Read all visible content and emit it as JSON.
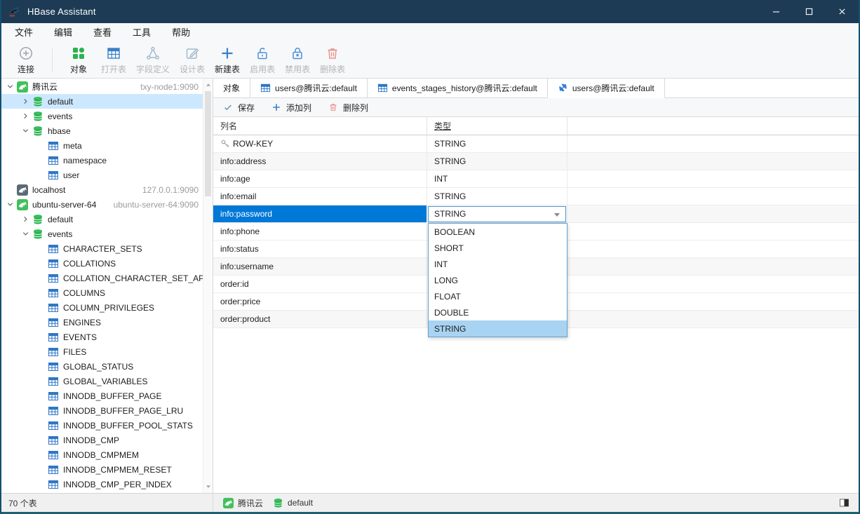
{
  "window": {
    "title": "HBase Assistant",
    "controls": [
      "minimize",
      "maximize",
      "close"
    ]
  },
  "menu": [
    "文件",
    "编辑",
    "查看",
    "工具",
    "帮助"
  ],
  "toolbar": [
    {
      "label": "连接",
      "icon": "connect-icon",
      "enabled": true,
      "sep_after": true
    },
    {
      "label": "对象",
      "icon": "objects-icon",
      "enabled": true
    },
    {
      "label": "打开表",
      "icon": "open-table-icon",
      "enabled": false
    },
    {
      "label": "字段定义",
      "icon": "field-def-icon",
      "enabled": false
    },
    {
      "label": "设计表",
      "icon": "design-table-icon",
      "enabled": false
    },
    {
      "label": "新建表",
      "icon": "new-table-icon",
      "enabled": true
    },
    {
      "label": "启用表",
      "icon": "enable-table-icon",
      "enabled": false
    },
    {
      "label": "禁用表",
      "icon": "disable-table-icon",
      "enabled": false
    },
    {
      "label": "删除表",
      "icon": "delete-table-icon",
      "enabled": false
    }
  ],
  "sidebar": {
    "items": [
      {
        "level": 0,
        "label": "腾讯云",
        "host": "txy-node1:9090",
        "icon": "dolphin-green-icon",
        "chevron": "down"
      },
      {
        "level": 1,
        "label": "default",
        "icon": "database-icon",
        "chevron": "right",
        "selected": true
      },
      {
        "level": 1,
        "label": "events",
        "icon": "database-icon",
        "chevron": "right"
      },
      {
        "level": 1,
        "label": "hbase",
        "icon": "database-icon",
        "chevron": "down"
      },
      {
        "level": 2,
        "label": "meta",
        "icon": "table-icon"
      },
      {
        "level": 2,
        "label": "namespace",
        "icon": "table-icon"
      },
      {
        "level": 2,
        "label": "user",
        "icon": "table-icon"
      },
      {
        "level": 0,
        "label": "localhost",
        "host": "127.0.0.1:9090",
        "icon": "dolphin-gray-icon",
        "chevron": "none"
      },
      {
        "level": 0,
        "label": "ubuntu-server-64",
        "host": "ubuntu-server-64:9090",
        "icon": "dolphin-green-icon",
        "chevron": "down"
      },
      {
        "level": 1,
        "label": "default",
        "icon": "database-icon",
        "chevron": "right"
      },
      {
        "level": 1,
        "label": "events",
        "icon": "database-icon",
        "chevron": "down"
      },
      {
        "level": 2,
        "label": "CHARACTER_SETS",
        "icon": "table-icon"
      },
      {
        "level": 2,
        "label": "COLLATIONS",
        "icon": "table-icon"
      },
      {
        "level": 2,
        "label": "COLLATION_CHARACTER_SET_APPL",
        "icon": "table-icon"
      },
      {
        "level": 2,
        "label": "COLUMNS",
        "icon": "table-icon"
      },
      {
        "level": 2,
        "label": "COLUMN_PRIVILEGES",
        "icon": "table-icon"
      },
      {
        "level": 2,
        "label": "ENGINES",
        "icon": "table-icon"
      },
      {
        "level": 2,
        "label": "EVENTS",
        "icon": "table-icon"
      },
      {
        "level": 2,
        "label": "FILES",
        "icon": "table-icon"
      },
      {
        "level": 2,
        "label": "GLOBAL_STATUS",
        "icon": "table-icon"
      },
      {
        "level": 2,
        "label": "GLOBAL_VARIABLES",
        "icon": "table-icon"
      },
      {
        "level": 2,
        "label": "INNODB_BUFFER_PAGE",
        "icon": "table-icon"
      },
      {
        "level": 2,
        "label": "INNODB_BUFFER_PAGE_LRU",
        "icon": "table-icon"
      },
      {
        "level": 2,
        "label": "INNODB_BUFFER_POOL_STATS",
        "icon": "table-icon"
      },
      {
        "level": 2,
        "label": "INNODB_CMP",
        "icon": "table-icon"
      },
      {
        "level": 2,
        "label": "INNODB_CMPMEM",
        "icon": "table-icon"
      },
      {
        "level": 2,
        "label": "INNODB_CMPMEM_RESET",
        "icon": "table-icon"
      },
      {
        "level": 2,
        "label": "INNODB_CMP_PER_INDEX",
        "icon": "table-icon"
      }
    ]
  },
  "tabs": [
    {
      "label": "对象",
      "icon": null,
      "active": false
    },
    {
      "label": "users@腾讯云:default",
      "icon": "table-icon",
      "active": false
    },
    {
      "label": "events_stages_history@腾讯云:default",
      "icon": "table-icon",
      "active": false
    },
    {
      "label": "users@腾讯云:default",
      "icon": "puzzle-icon",
      "active": true
    }
  ],
  "subtoolbar": [
    {
      "label": "保存",
      "icon": "check-icon"
    },
    {
      "label": "添加列",
      "icon": "add-column-icon"
    },
    {
      "label": "删除列",
      "icon": "delete-column-icon"
    }
  ],
  "grid": {
    "columns": [
      "列名",
      "类型"
    ],
    "rows": [
      {
        "name": "ROW-KEY",
        "type": "STRING",
        "key": true
      },
      {
        "name": "info:address",
        "type": "STRING"
      },
      {
        "name": "info:age",
        "type": "INT"
      },
      {
        "name": "info:email",
        "type": "STRING"
      },
      {
        "name": "info:password",
        "type": "STRING",
        "selected": true,
        "editing": true
      },
      {
        "name": "info:phone",
        "type": ""
      },
      {
        "name": "info:status",
        "type": ""
      },
      {
        "name": "info:username",
        "type": ""
      },
      {
        "name": "order:id",
        "type": ""
      },
      {
        "name": "order:price",
        "type": ""
      },
      {
        "name": "order:product",
        "type": ""
      }
    ]
  },
  "type_dropdown": {
    "value": "STRING",
    "options": [
      "BOOLEAN",
      "SHORT",
      "INT",
      "LONG",
      "FLOAT",
      "DOUBLE",
      "STRING"
    ],
    "highlighted": "STRING"
  },
  "statusbar": {
    "tables_count": "70 个表",
    "connection": "腾讯云",
    "database": "default"
  },
  "colors": {
    "titlebar": "#1d3b55",
    "accent": "#0078d7",
    "tree_selection": "#cce8ff",
    "icon_blue": "#3b7fc9",
    "icon_green": "#2ab34f",
    "icon_red": "#e8938a",
    "dropdown_highlight": "#a9d3f2",
    "stripe": "#f7f7f7"
  }
}
